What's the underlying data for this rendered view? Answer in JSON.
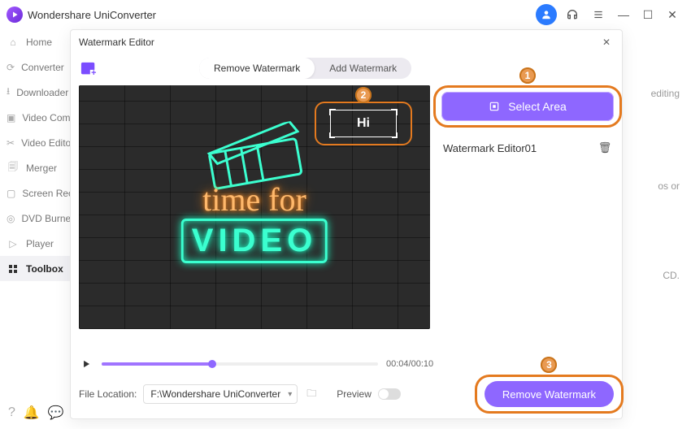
{
  "app": {
    "name": "Wondershare UniConverter"
  },
  "sidebar": {
    "items": [
      {
        "label": "Home"
      },
      {
        "label": "Converter"
      },
      {
        "label": "Downloader"
      },
      {
        "label": "Video Compressor"
      },
      {
        "label": "Video Editor"
      },
      {
        "label": "Merger"
      },
      {
        "label": "Screen Recorder"
      },
      {
        "label": "DVD Burner"
      },
      {
        "label": "Player"
      },
      {
        "label": "Toolbox"
      }
    ]
  },
  "ghost": {
    "editing": "editing",
    "or": "os or",
    "cd": "CD."
  },
  "dialog": {
    "title": "Watermark Editor",
    "tabs": {
      "remove": "Remove Watermark",
      "add": "Add Watermark"
    },
    "video": {
      "neon1": "time for",
      "neon2": "VIDEO",
      "watermark_text": "Hi"
    },
    "select_area": "Select Area",
    "list": [
      {
        "name": "Watermark Editor01"
      }
    ],
    "time": "00:04/00:10",
    "file_location_label": "File Location:",
    "file_location_value": "F:\\Wondershare UniConverter",
    "preview_label": "Preview",
    "primary": "Remove Watermark"
  },
  "annotations": {
    "a1": "1",
    "a2": "2",
    "a3": "3"
  }
}
